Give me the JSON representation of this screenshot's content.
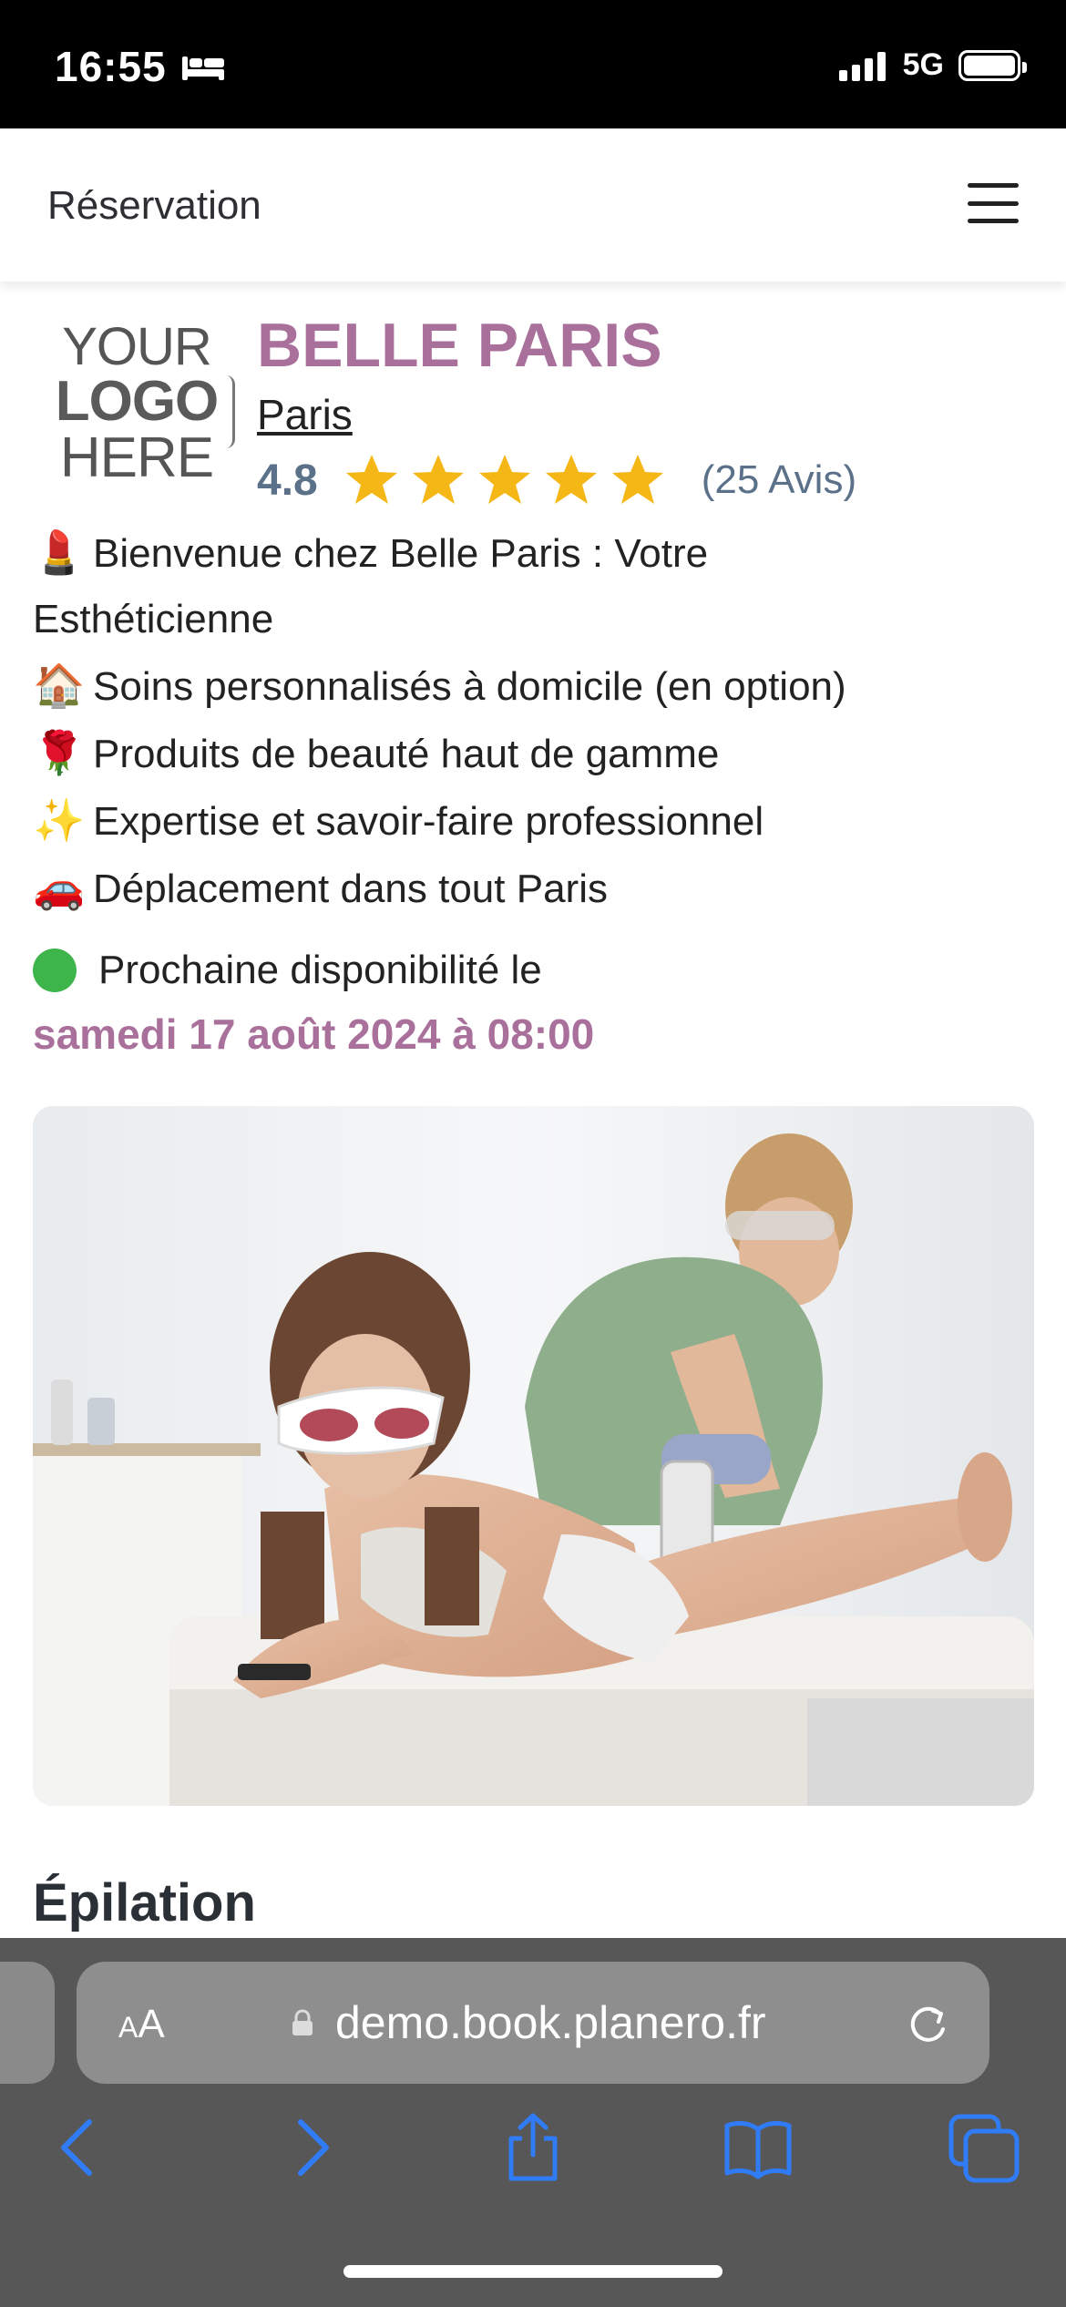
{
  "status_bar": {
    "time": "16:55",
    "network": "5G"
  },
  "header": {
    "title": "Réservation"
  },
  "logo": {
    "line1": "YOUR",
    "line2": "LOGO",
    "line3": "HERE"
  },
  "business": {
    "name": "BELLE PARIS",
    "city": "Paris",
    "rating": "4.8",
    "stars": 5,
    "reviews": "(25 Avis)",
    "star_color": "#f5b716"
  },
  "description": [
    {
      "emoji": "💄",
      "text": "Bienvenue chez Belle Paris : Votre"
    },
    {
      "emoji": "",
      "text": "Esthéticienne"
    },
    {
      "emoji": "🏠",
      "text": "Soins personnalisés à domicile  (en option)"
    },
    {
      "emoji": "🌹",
      "text": "Produits de beauté haut de gamme"
    },
    {
      "emoji": "✨",
      "text": "Expertise et savoir-faire professionnel"
    },
    {
      "emoji": "🚗",
      "text": "Déplacement dans tout Paris"
    }
  ],
  "availability": {
    "label": "Prochaine disponibilité le",
    "date": "samedi 17 août 2024 à 08:00",
    "status_color": "#3db54a"
  },
  "section": {
    "title": "Épilation"
  },
  "browser": {
    "text_size_button": {
      "small": "A",
      "large": "A"
    },
    "url": "demo.book.planero.fr"
  },
  "colors": {
    "accent": "#a8709b",
    "rating_text": "#5a7189",
    "ios_blue": "#2f7cf6"
  }
}
